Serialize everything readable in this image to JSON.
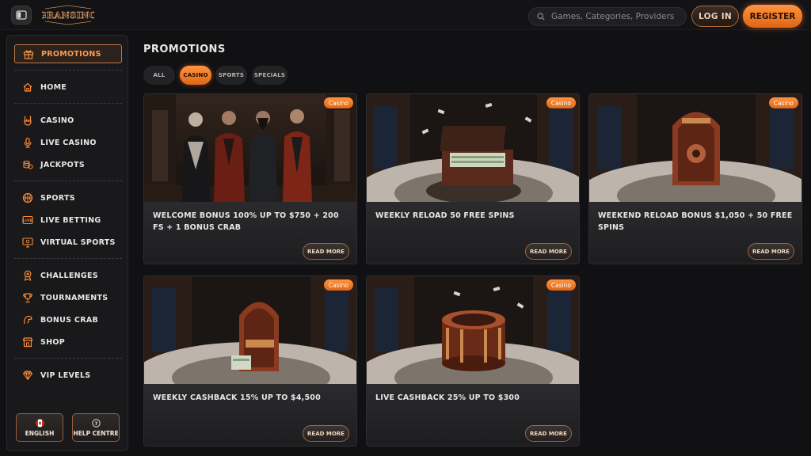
{
  "header": {
    "logo_text": "GRANSINO",
    "search_placeholder": "Games, Categories, Providers",
    "login_label": "LOG IN",
    "register_label": "REGISTER"
  },
  "sidebar": {
    "items": [
      {
        "label": "PROMOTIONS",
        "icon": "gift-icon",
        "active": true
      },
      {
        "label": "HOME",
        "icon": "home-icon"
      },
      {
        "label": "CASINO",
        "icon": "rock-hand-icon"
      },
      {
        "label": "LIVE CASINO",
        "icon": "microphone-icon"
      },
      {
        "label": "JACKPOTS",
        "icon": "coins-icon"
      },
      {
        "label": "SPORTS",
        "icon": "basketball-icon"
      },
      {
        "label": "LIVE BETTING",
        "icon": "live-icon"
      },
      {
        "label": "VIRTUAL SPORTS",
        "icon": "monitor-icon"
      },
      {
        "label": "CHALLENGES",
        "icon": "medal-icon"
      },
      {
        "label": "TOURNAMENTS",
        "icon": "trophy-icon"
      },
      {
        "label": "BONUS CRAB",
        "icon": "crab-claw-icon"
      },
      {
        "label": "SHOP",
        "icon": "shop-icon"
      },
      {
        "label": "VIP LEVELS",
        "icon": "diamond-icon"
      }
    ],
    "footer": {
      "language_label": "ENGLISH",
      "help_label": "HELP CENTRE"
    }
  },
  "main": {
    "title": "PROMOTIONS",
    "tabs": [
      {
        "label": "ALL",
        "active": false
      },
      {
        "label": "CASINO",
        "active": true
      },
      {
        "label": "SPORTS",
        "active": false
      },
      {
        "label": "SPECIALS",
        "active": false
      }
    ],
    "cards": [
      {
        "title": "WELCOME BONUS 100% UP TO $750 + 200 FS + 1 BONUS CRAB",
        "badge": "Casino",
        "button": "READ MORE",
        "art": "characters"
      },
      {
        "title": "WEEKLY RELOAD 50 FREE SPINS",
        "badge": "Casino",
        "button": "READ MORE",
        "art": "briefcase"
      },
      {
        "title": "WEEKEND RELOAD BONUS $1,050 + 50 FREE SPINS",
        "badge": "Casino",
        "button": "READ MORE",
        "art": "safe"
      },
      {
        "title": "WEEKLY CASHBACK 15% UP TO $4,500",
        "badge": "Casino",
        "button": "READ MORE",
        "art": "jukebox"
      },
      {
        "title": "LIVE CASHBACK 25% UP TO $300",
        "badge": "Casino",
        "button": "READ MORE",
        "art": "roulette"
      }
    ]
  },
  "colors": {
    "accent": "#ff8a33",
    "accent_dark": "#e06514",
    "background": "#111113",
    "panel": "#19191b"
  }
}
